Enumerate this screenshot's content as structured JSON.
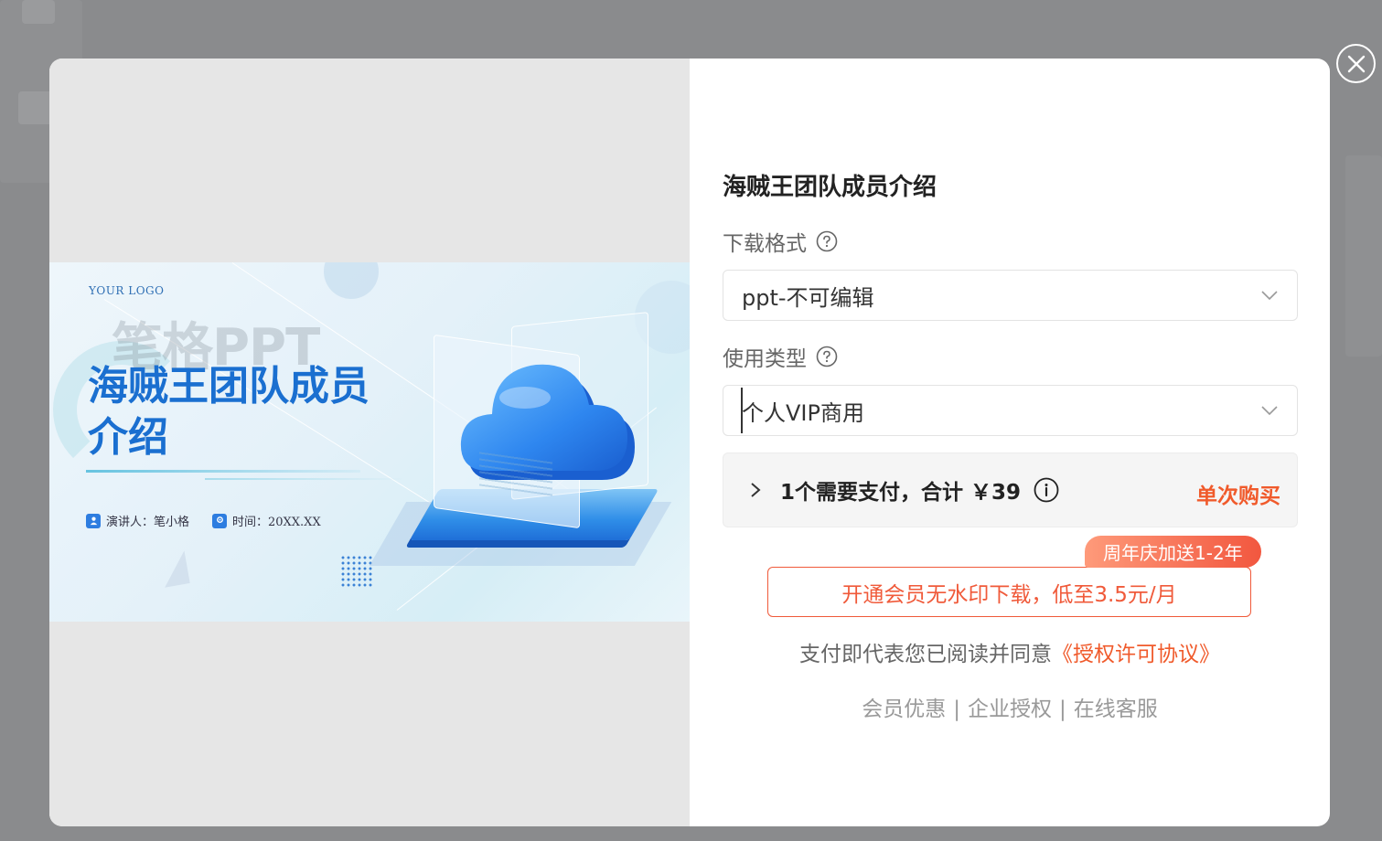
{
  "preview": {
    "logo_text": "YOUR LOGO",
    "watermark": "笔格PPT",
    "slide_title": "海贼王团队成员介绍",
    "presenter_label": "演讲人：笔小格",
    "time_label": "时间：20XX.XX"
  },
  "form": {
    "title": "海贼王团队成员介绍",
    "format_label": "下载格式",
    "format_value": "ppt-不可编辑",
    "usage_label": "使用类型",
    "usage_value": "个人VIP商用",
    "summary_total": "1个需要支付，合计 ￥39",
    "summary_single": "单次购买",
    "promo_badge": "周年庆加送1-2年",
    "vip_button": "开通会员无水印下载，低至3.5元/月",
    "agree_prefix": "支付即代表您已阅读并同意",
    "agree_link": "《授权许可协议》",
    "footer_links": [
      "会员优惠",
      "企业授权",
      "在线客服"
    ],
    "footer_separator": "|"
  },
  "colors": {
    "accent": "#f05a2b",
    "badge_start": "#fe9a7a",
    "badge_end": "#f2573f",
    "slide_title": "#1a6fd0"
  },
  "icons": {
    "close": "close-icon",
    "help": "question-circle-icon",
    "dropdown": "chevron-down-icon",
    "expand": "chevron-right-icon",
    "info": "info-circle-icon"
  }
}
